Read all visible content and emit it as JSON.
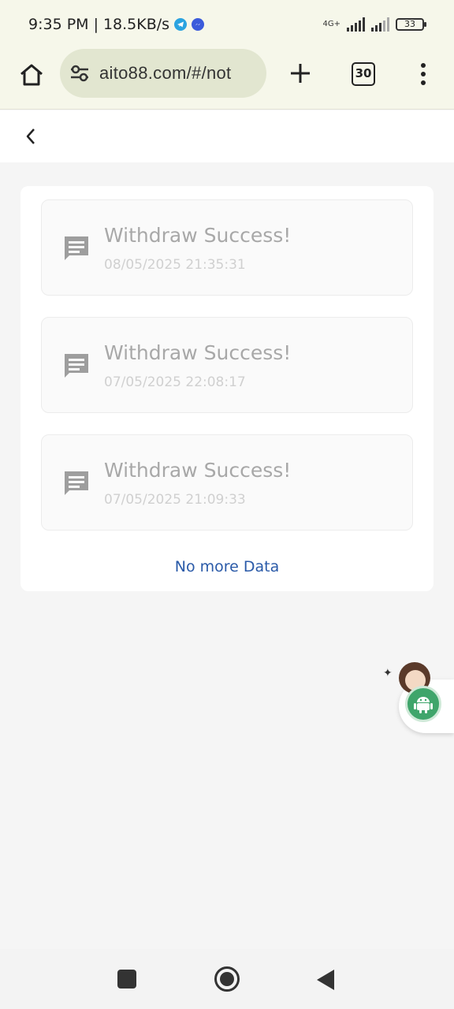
{
  "status_bar": {
    "time": "9:35 PM",
    "separator": "|",
    "net_speed": "18.5KB/s",
    "network_label": "4G+",
    "battery": "33"
  },
  "browser": {
    "url": "aito88.com/#/not",
    "tab_count": "30"
  },
  "notices": [
    {
      "title": "Withdraw Success!",
      "time": "08/05/2025 21:35:31"
    },
    {
      "title": "Withdraw Success!",
      "time": "07/05/2025 22:08:17"
    },
    {
      "title": "Withdraw Success!",
      "time": "07/05/2025 21:09:33"
    }
  ],
  "footer": {
    "no_more": "No more Data"
  },
  "colors": {
    "link_blue": "#2a5aa8",
    "android_green": "#3fa56b",
    "browser_bg": "#f6f7ea"
  }
}
